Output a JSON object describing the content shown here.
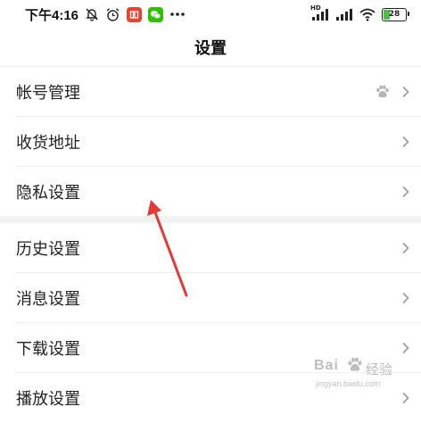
{
  "status_bar": {
    "time": "下午4:16",
    "left_icons": [
      "silent-bell-icon",
      "alarm-clock-icon",
      "red-app-icon",
      "wechat-icon",
      "more-dots-icon"
    ],
    "hd_label": "HD",
    "right_icons": [
      "signal-hd-icon",
      "signal-icon",
      "wifi-icon"
    ],
    "battery": "28"
  },
  "header": {
    "title": "设置"
  },
  "groups": [
    {
      "items": [
        {
          "label": "帐号管理",
          "icon": "baidu-paw-icon"
        },
        {
          "label": "收货地址"
        },
        {
          "label": "隐私设置"
        }
      ]
    },
    {
      "items": [
        {
          "label": "历史设置"
        },
        {
          "label": "消息设置"
        },
        {
          "label": "下载设置"
        },
        {
          "label": "播放设置"
        }
      ]
    }
  ],
  "annotation": {
    "color": "#e53935",
    "description": "red arrow pointing to 隐私设置"
  },
  "watermark": {
    "brand": "Bai",
    "brand_suffix": "经验",
    "url": "jingyan.baidu.com"
  },
  "colors": {
    "background": "#ffffff",
    "section_gap": "#f2f2f2",
    "chevron": "#999999",
    "wechat": "#2dc100",
    "app_red": "#e8432e"
  }
}
